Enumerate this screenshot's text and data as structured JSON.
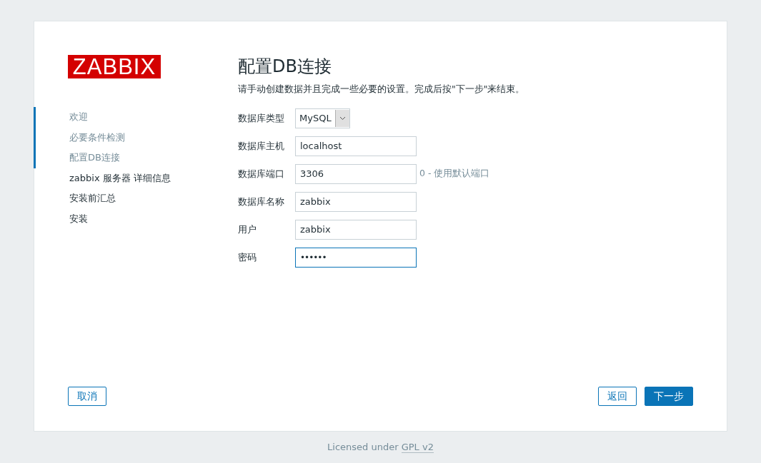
{
  "logo": {
    "text": "ZABBIX"
  },
  "steps": [
    {
      "label": "欢迎",
      "completed": true
    },
    {
      "label": "必要条件检测",
      "completed": true
    },
    {
      "label": "配置DB连接",
      "completed": true
    },
    {
      "label": "zabbix 服务器 详细信息",
      "completed": false
    },
    {
      "label": "安装前汇总",
      "completed": false
    },
    {
      "label": "安装",
      "completed": false
    }
  ],
  "title": "配置DB连接",
  "intro": "请手动创建数据并且完成一些必要的设置。完成后按\"下一步\"来结束。",
  "fields": [
    {
      "label": "数据库类型",
      "kind": "select",
      "value": "MySQL"
    },
    {
      "label": "数据库主机",
      "kind": "text",
      "value": "localhost",
      "focused": false
    },
    {
      "label": "数据库端口",
      "kind": "text",
      "value": "3306",
      "hint": "0 - 使用默认端口",
      "focused": false
    },
    {
      "label": "数据库名称",
      "kind": "text",
      "value": "zabbix",
      "focused": false
    },
    {
      "label": "用户",
      "kind": "text",
      "value": "zabbix",
      "focused": false
    },
    {
      "label": "密码",
      "kind": "password",
      "value": "••••••",
      "focused": true
    }
  ],
  "buttons": {
    "cancel": "取消",
    "back": "返回",
    "next": "下一步"
  },
  "footer": {
    "text": "Licensed under",
    "link": "GPL v2"
  }
}
